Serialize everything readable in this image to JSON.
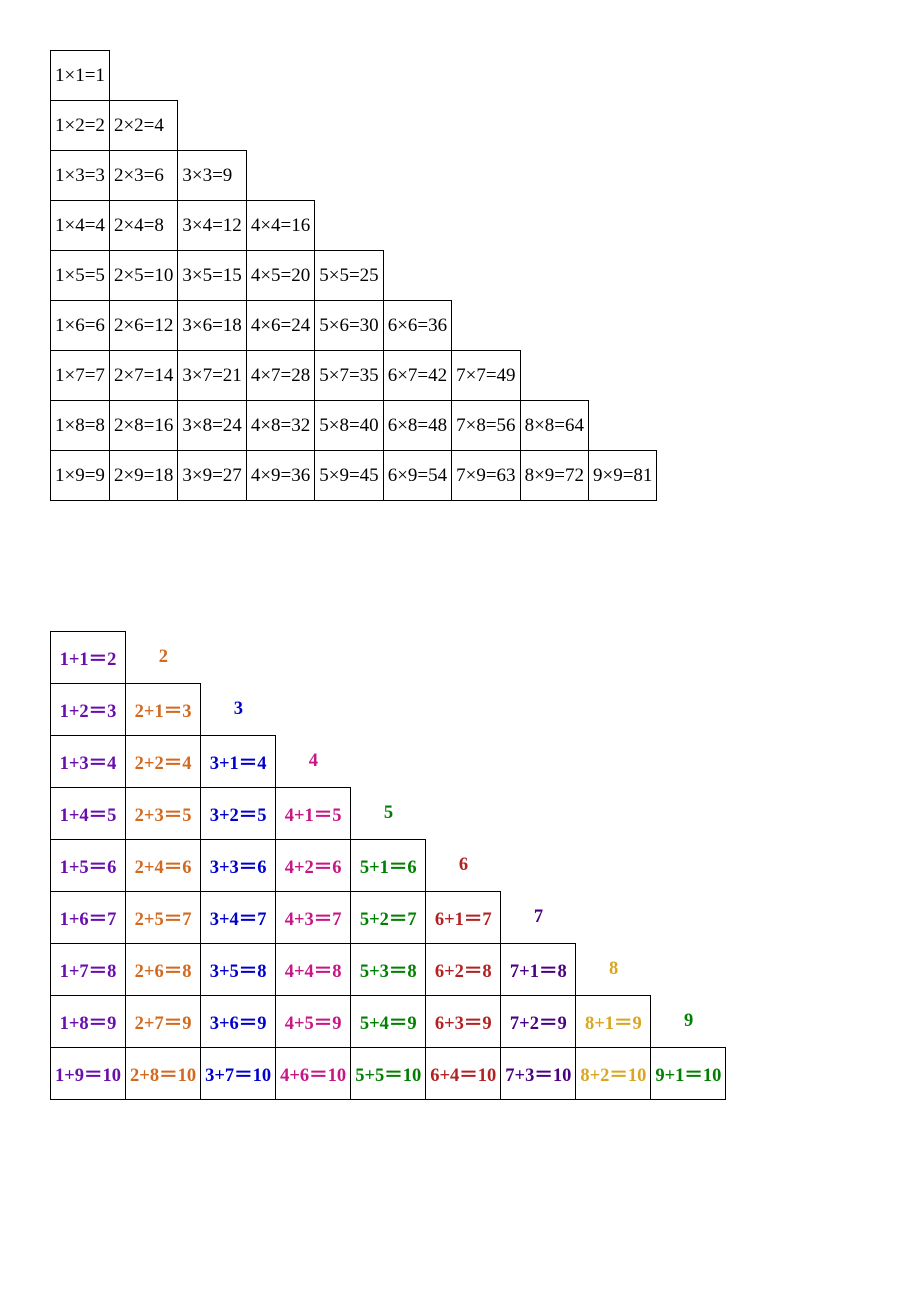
{
  "chart_data": [
    {
      "type": "table",
      "title": "Multiplication Table 1-9",
      "rows": [
        [
          "1×1=1"
        ],
        [
          "1×2=2",
          "2×2=4"
        ],
        [
          "1×3=3",
          "2×3=6",
          "3×3=9"
        ],
        [
          "1×4=4",
          "2×4=8",
          "3×4=12",
          "4×4=16"
        ],
        [
          "1×5=5",
          "2×5=10",
          "3×5=15",
          "4×5=20",
          "5×5=25"
        ],
        [
          "1×6=6",
          "2×6=12",
          "3×6=18",
          "4×6=24",
          "5×6=30",
          "6×6=36"
        ],
        [
          "1×7=7",
          "2×7=14",
          "3×7=21",
          "4×7=28",
          "5×7=35",
          "6×7=42",
          "7×7=49"
        ],
        [
          "1×8=8",
          "2×8=16",
          "3×8=24",
          "4×8=32",
          "5×8=40",
          "6×8=48",
          "7×8=56",
          "8×8=64"
        ],
        [
          "1×9=9",
          "2×9=18",
          "3×9=27",
          "4×9=36",
          "5×9=45",
          "6×9=54",
          "7×9=63",
          "8×9=72",
          "9×9=81"
        ]
      ]
    },
    {
      "type": "table",
      "title": "Addition Table 1-9",
      "rows": [
        [
          "1+1＝2",
          "2"
        ],
        [
          "1+2＝3",
          "2+1＝3",
          "3"
        ],
        [
          "1+3＝4",
          "2+2＝4",
          "3+1＝4",
          "4"
        ],
        [
          "1+4＝5",
          "2+3＝5",
          "3+2＝5",
          "4+1＝5",
          "5"
        ],
        [
          "1+5＝6",
          "2+4＝6",
          "3+3＝6",
          "4+2＝6",
          "5+1＝6",
          "6"
        ],
        [
          "1+6＝7",
          "2+5＝7",
          "3+4＝7",
          "4+3＝7",
          "5+2＝7",
          "6+1＝7",
          "7"
        ],
        [
          "1+7＝8",
          "2+6＝8",
          "3+5＝8",
          "4+4＝8",
          "5+3＝8",
          "6+2＝8",
          "7+1＝8",
          "8"
        ],
        [
          "1+8＝9",
          "2+7＝9",
          "3+6＝9",
          "4+5＝9",
          "5+4＝9",
          "6+3＝9",
          "7+2＝9",
          "8+1＝9",
          "9"
        ],
        [
          "1+9＝10",
          "2+8＝10",
          "3+7＝10",
          "4+6＝10",
          "5+5＝10",
          "6+4＝10",
          "7+3＝10",
          "8+2＝10",
          "9+1＝10"
        ]
      ],
      "column_colors": [
        "#6a0dad",
        "#d2691e",
        "#0000cd",
        "#c71585",
        "#008000",
        "#b22222",
        "#4b0082",
        "#daa520",
        "#008000"
      ]
    }
  ]
}
